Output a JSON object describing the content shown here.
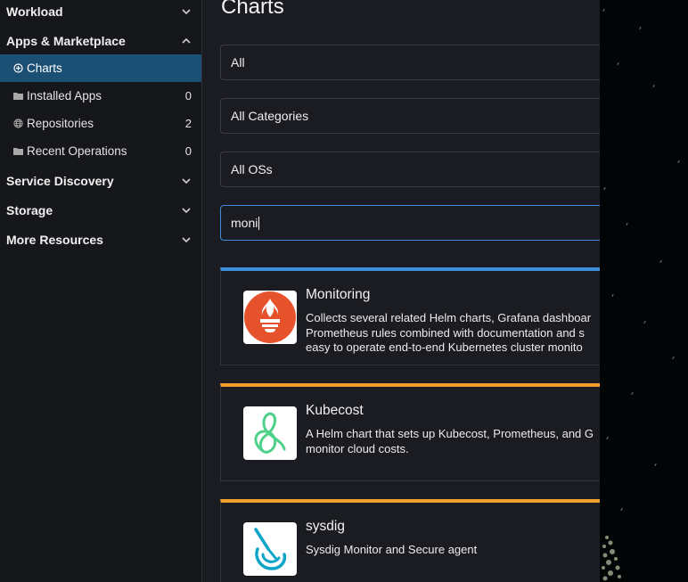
{
  "sidebar": {
    "groups_top": [
      {
        "label": "Workload",
        "chevron": "chevron-down-icon"
      },
      {
        "label": "Apps & Marketplace",
        "chevron": "chevron-up-icon"
      }
    ],
    "items": [
      {
        "label": "Charts",
        "icon": "plus-circle-icon",
        "count": "",
        "active": true
      },
      {
        "label": "Installed Apps",
        "icon": "folder-icon",
        "count": "0",
        "active": false
      },
      {
        "label": "Repositories",
        "icon": "globe-icon",
        "count": "2",
        "active": false
      },
      {
        "label": "Recent Operations",
        "icon": "folder-icon",
        "count": "0",
        "active": false
      }
    ],
    "groups_bottom": [
      {
        "label": "Service Discovery",
        "chevron": "chevron-down-icon"
      },
      {
        "label": "Storage",
        "chevron": "chevron-down-icon"
      },
      {
        "label": "More Resources",
        "chevron": "chevron-down-icon"
      }
    ]
  },
  "main": {
    "title": "Charts",
    "filters": {
      "repository": "All",
      "category": "All Categories",
      "os": "All OSs",
      "search_value": "moni"
    },
    "cards": [
      {
        "name": "Monitoring",
        "description_lines": [
          "Collects several related Helm charts, Grafana dashboar",
          "Prometheus rules combined with documentation and s",
          "easy to operate end-to-end Kubernetes cluster monito"
        ],
        "accent": "#3d8ed8",
        "logo": "prometheus-logo-icon"
      },
      {
        "name": "Kubecost",
        "description_lines": [
          "A Helm chart that sets up Kubecost, Prometheus, and G",
          "monitor cloud costs."
        ],
        "accent": "#f0a02a",
        "logo": "kubecost-logo-icon"
      },
      {
        "name": "sysdig",
        "description_lines": [
          "Sysdig Monitor and Secure agent"
        ],
        "accent": "#f0a02a",
        "logo": "sysdig-logo-icon"
      }
    ]
  },
  "colors": {
    "sidebar_bg": "#16171b",
    "active_bg": "#1c4f74",
    "main_bg": "#1b1c21",
    "focus_border": "#3d8ed8",
    "card_accent_blue": "#3d8ed8",
    "card_accent_orange": "#f0a02a"
  }
}
